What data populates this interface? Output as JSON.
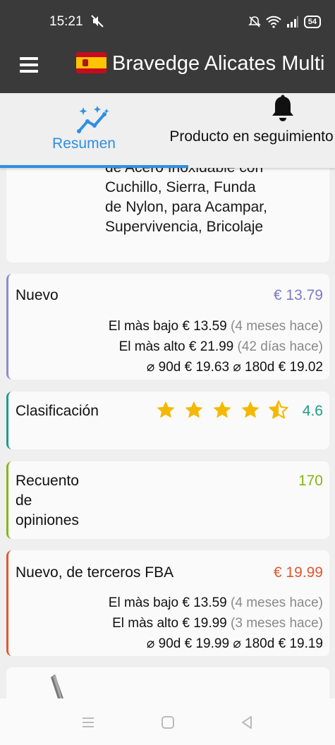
{
  "status_bar": {
    "time": "15:21",
    "battery": "54"
  },
  "app_bar": {
    "title": "Bravedge Alicates Multi"
  },
  "tabs": [
    {
      "label": "Resumen",
      "icon": "sparkle-chart-icon",
      "active": true
    },
    {
      "label": "Producto en seguimiento",
      "icon": "bell-icon",
      "active": false
    }
  ],
  "product": {
    "title_lines": [
      "de Acero Inoxidable con",
      "Cuchillo, Sierra, Funda",
      "de Nylon, para Acampar,",
      "Supervivencia, Bricolaje"
    ]
  },
  "nuevo": {
    "label": "Nuevo",
    "price": "€ 13.79",
    "color": "#7b7bc8",
    "lowest_label": "El màs bajo",
    "lowest": "€ 13.59",
    "lowest_when": "(4 meses hace)",
    "highest_label": "El màs alto",
    "highest": "€ 21.99",
    "highest_when": "(42 días hace)",
    "avg90_label": "⌀ 90d",
    "avg90": "€ 19.63",
    "avg180_label": "⌀ 180d",
    "avg180": "€ 19.02"
  },
  "rating": {
    "label": "Clasificación",
    "value": "4.6",
    "stars_filled": 4,
    "stars_half": 1,
    "color": "#1e9a8a"
  },
  "reviews": {
    "label": "Recuento de opiniones",
    "value": "170",
    "color": "#86b514"
  },
  "fba": {
    "label": "Nuevo, de terceros FBA",
    "price": "€ 19.99",
    "color": "#e0572e",
    "lowest_label": "El màs bajo",
    "lowest": "€ 13.59",
    "lowest_when": "(4 meses hace)",
    "highest_label": "El màs alto",
    "highest": "€ 19.99",
    "highest_when": "(3 meses hace)",
    "avg90_label": "⌀ 90d",
    "avg90": "€ 19.99",
    "avg180_label": "⌀ 180d",
    "avg180": "€ 19.19"
  },
  "colors": {
    "accent_blue": "#2f8ee2",
    "star": "#f5b800",
    "dark_bar": "#3a3a3a"
  }
}
